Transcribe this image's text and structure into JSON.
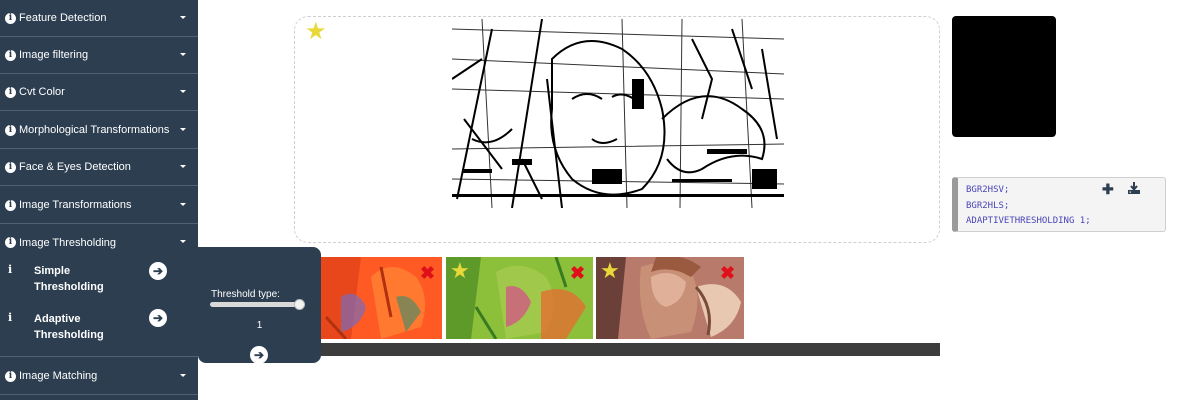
{
  "sidebar": {
    "items": [
      {
        "label": "Feature Detection"
      },
      {
        "label": "Image filtering"
      },
      {
        "label": "Cvt Color"
      },
      {
        "label": "Morphological Transformations"
      },
      {
        "label": "Face & Eyes Detection"
      },
      {
        "label": "Image Transformations"
      },
      {
        "label": "Image Thresholding"
      },
      {
        "label": "Image Matching"
      }
    ],
    "thresholding_sub": [
      {
        "label": "Simple Thresholding"
      },
      {
        "label": "Adaptive Thresholding"
      }
    ]
  },
  "popover": {
    "threshold_label": "Threshold type:",
    "threshold_value": "1"
  },
  "code": {
    "lines": [
      "BGR2HSV;",
      "BGR2HLS;",
      "ADAPTIVETHRESHOLDING 1;"
    ]
  },
  "colors": {
    "sidebar_bg": "#2c3e50",
    "star": "#e8d83a",
    "delete": "#e0101a",
    "code_text": "#4a45b8"
  },
  "icons": [
    "info-icon",
    "chevron-down-icon",
    "arrow-circle-right-icon",
    "star-icon",
    "close-icon",
    "plus-icon",
    "download-icon"
  ]
}
